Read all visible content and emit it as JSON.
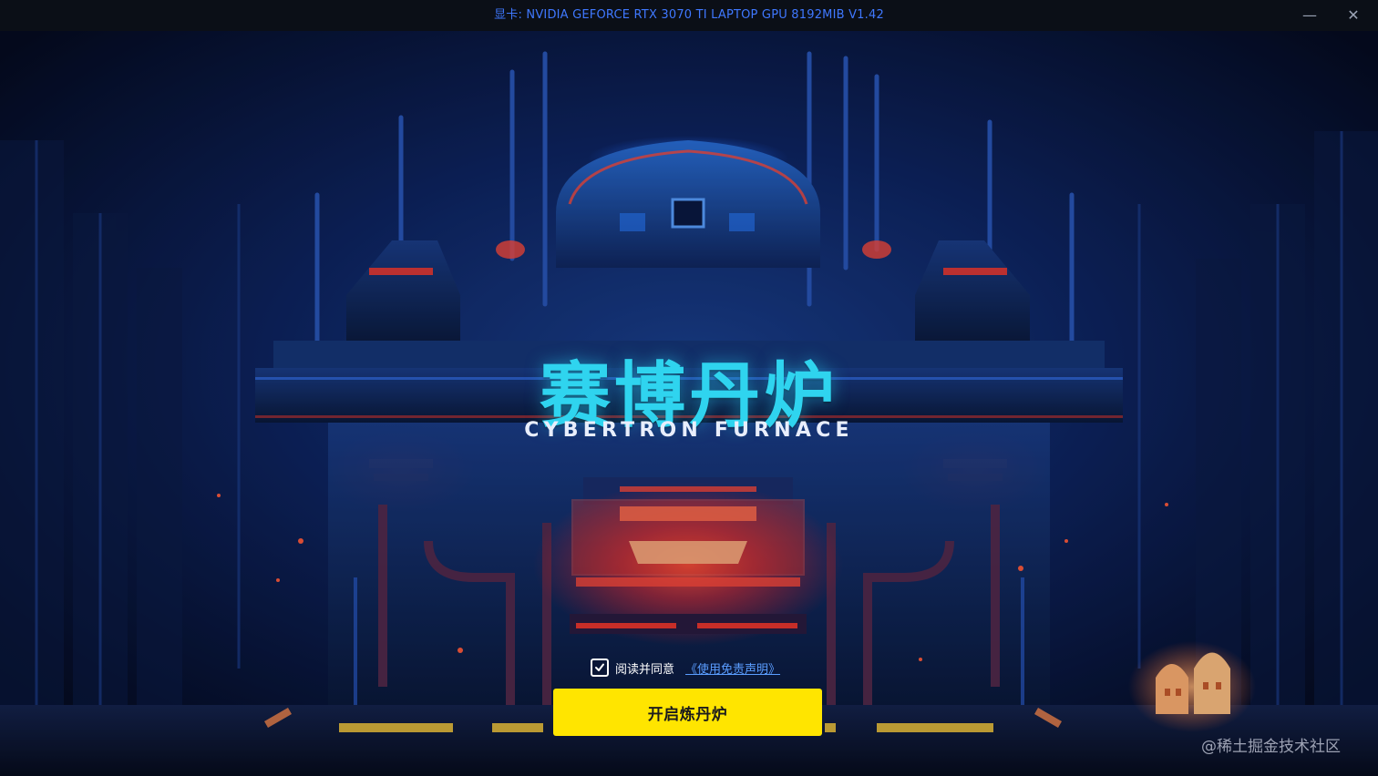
{
  "window": {
    "title": "显卡: NVIDIA GEFORCE RTX 3070 TI LAPTOP GPU 8192MIB  V1.42",
    "minimize_glyph": "—",
    "close_glyph": "✕"
  },
  "brand": {
    "title_cn": "赛博丹炉",
    "title_en": "CYBERTRON FURNACE"
  },
  "agreement": {
    "checked": true,
    "text": "阅读并同意",
    "link": "《使用免责声明》"
  },
  "start_button": {
    "label": "开启炼丹炉"
  },
  "watermark": "@稀土掘金技术社区",
  "colors": {
    "title_bar_text": "#3f78ff",
    "brand_cyan": "#2fd4ef",
    "button_yellow": "#ffe500",
    "link_blue": "#5a9dff",
    "neon_red": "#ff3a2a"
  },
  "icons": {
    "checkbox": "check-icon",
    "minimize": "minimize-icon",
    "close": "close-icon"
  }
}
